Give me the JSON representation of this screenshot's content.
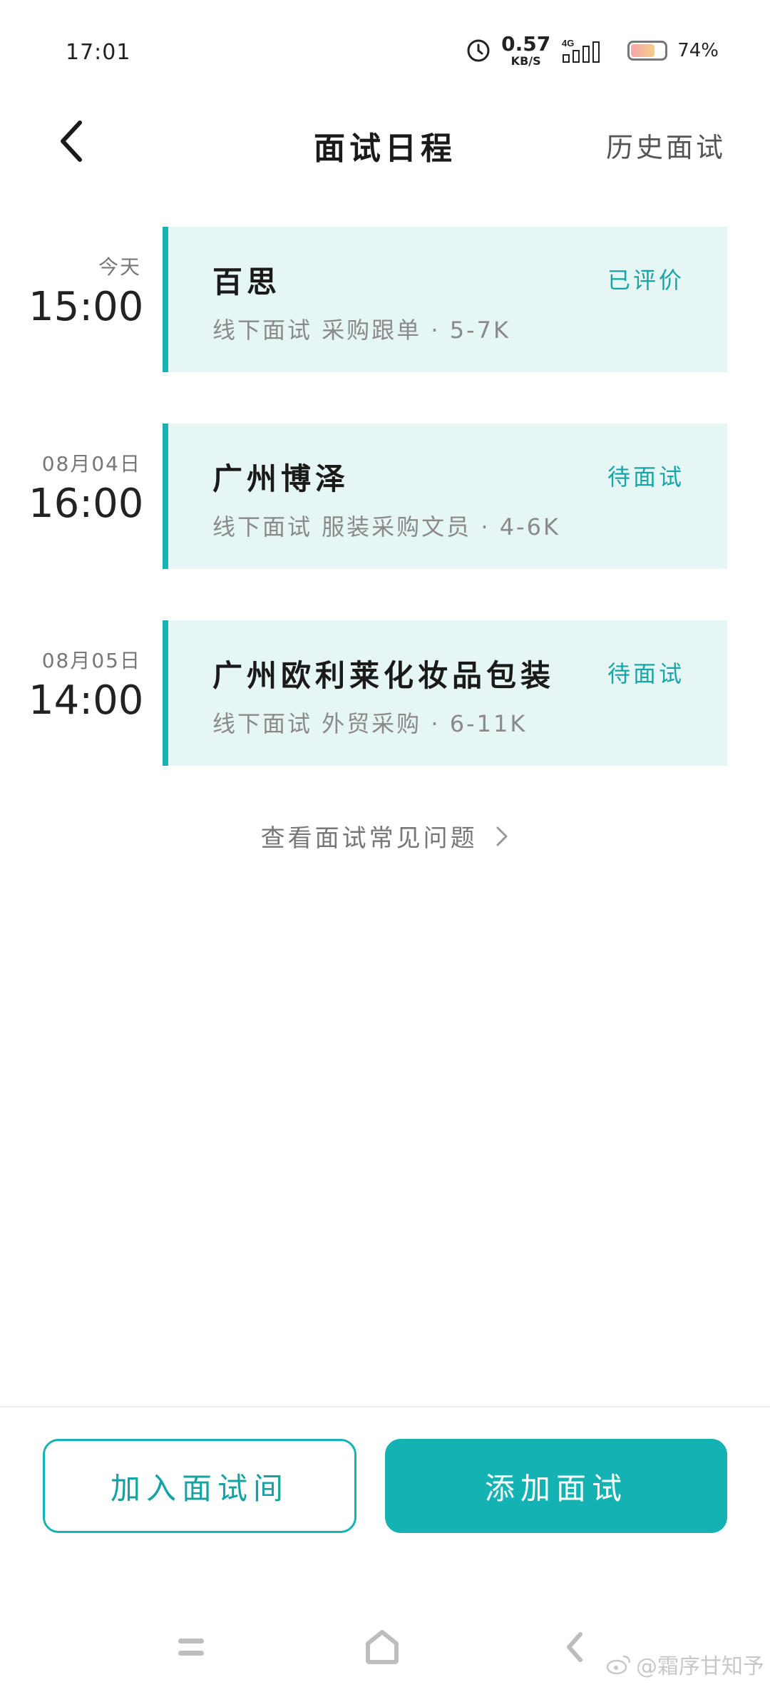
{
  "status_bar": {
    "time": "17:01",
    "net_speed_value": "0.57",
    "net_speed_unit": "KB/S",
    "network": "4G",
    "battery_level": 0.74,
    "battery_text": "74%"
  },
  "header": {
    "title": "面试日程",
    "history_label": "历史面试"
  },
  "interviews": [
    {
      "date": "今天",
      "time": "15:00",
      "company": "百思",
      "status": "已评价",
      "detail": "线下面试 采购跟单 · 5-7K"
    },
    {
      "date": "08月04日",
      "time": "16:00",
      "company": "广州博泽",
      "status": "待面试",
      "detail": "线下面试 服装采购文员 · 4-6K"
    },
    {
      "date": "08月05日",
      "time": "14:00",
      "company": "广州欧利莱化妆品包装",
      "status": "待面试",
      "detail": "线下面试 外贸采购 · 6-11K"
    }
  ],
  "faq_link": "查看面试常见问题",
  "buttons": {
    "join_room": "加入面试间",
    "add_interview": "添加面试"
  },
  "watermark": "@霜序甘知予",
  "colors": {
    "accent": "#17b2b3",
    "card_bg": "#e6f6f5"
  }
}
